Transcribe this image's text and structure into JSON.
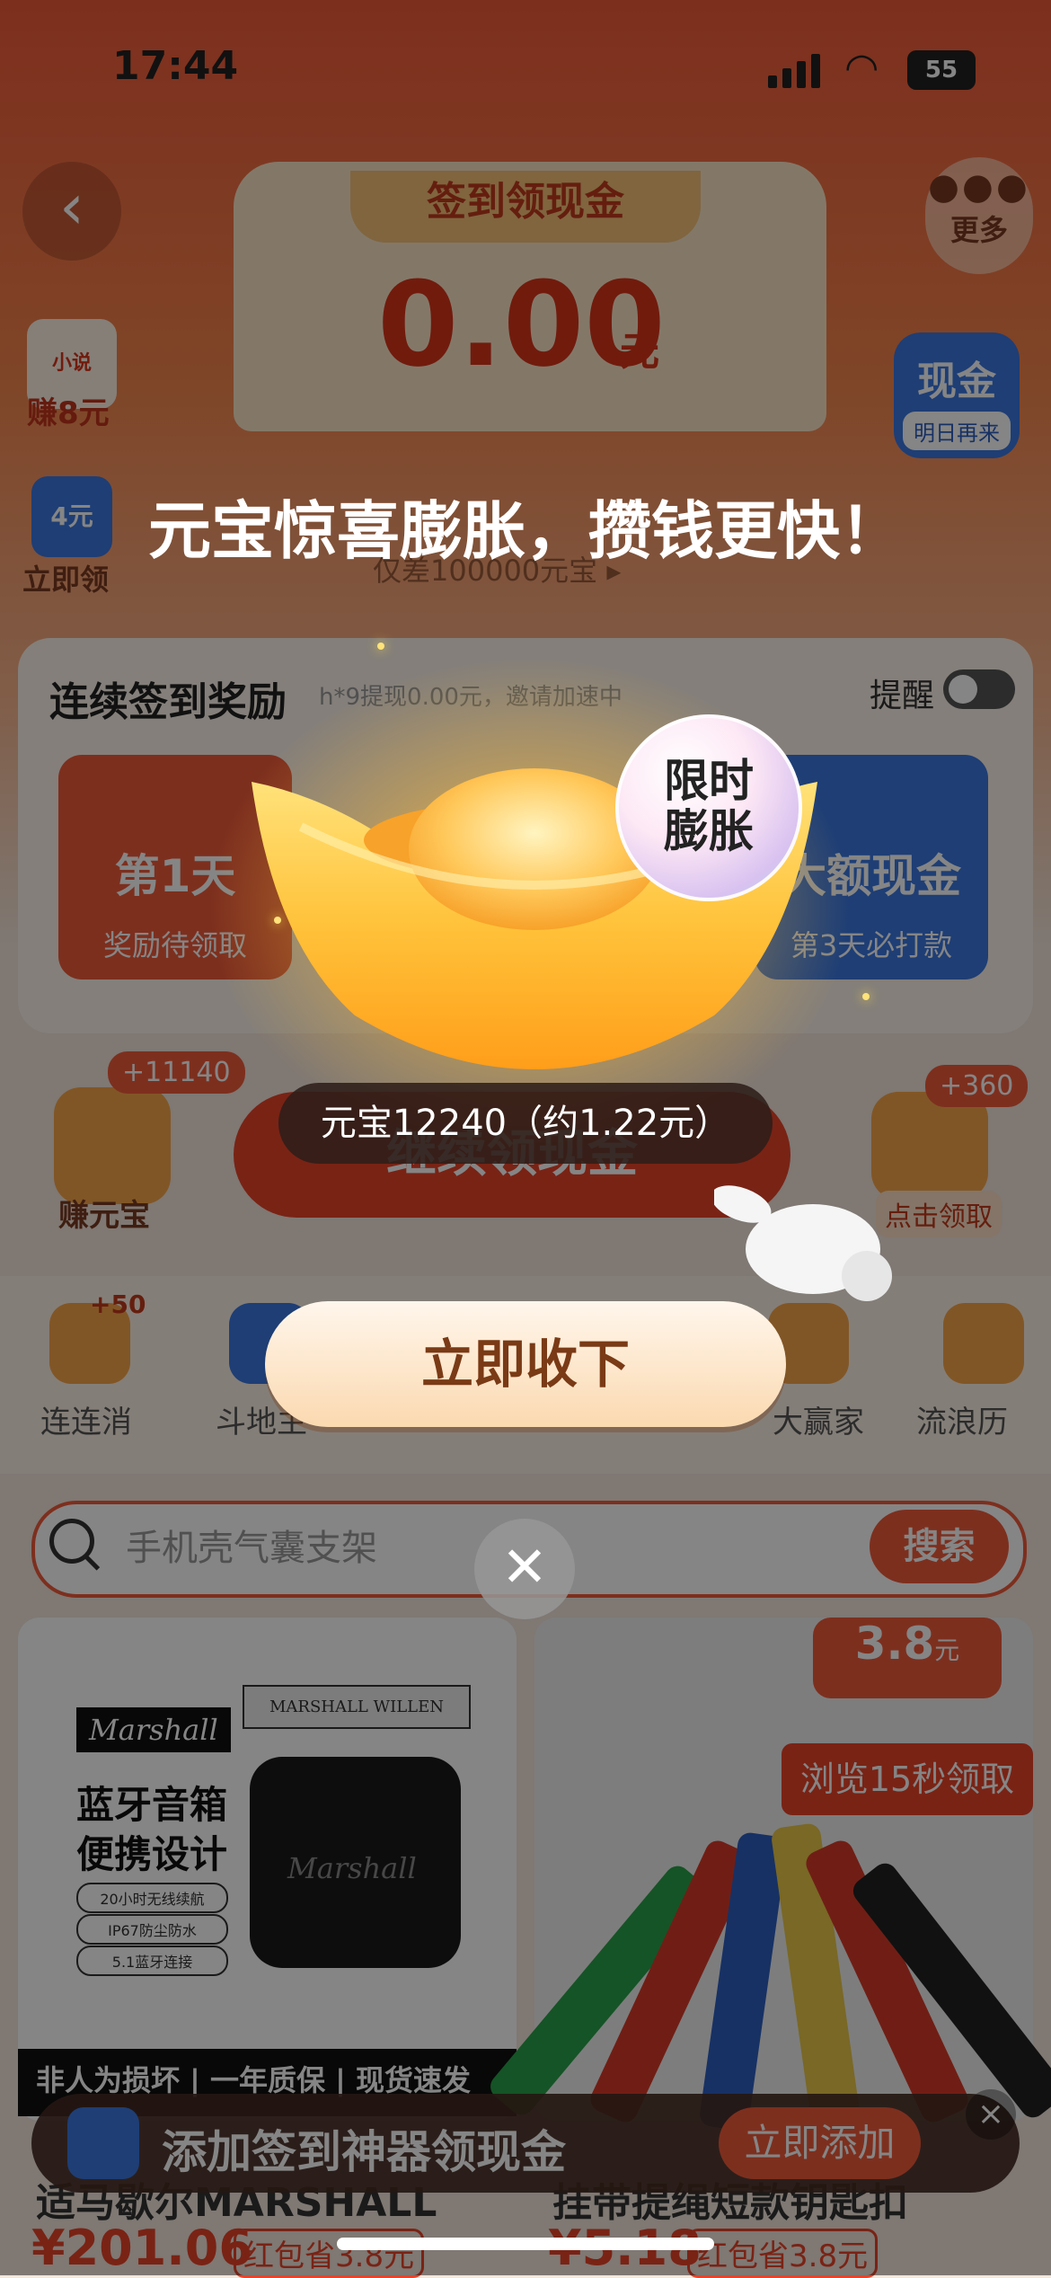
{
  "status_bar": {
    "time": "17:44",
    "battery": "55"
  },
  "header": {
    "back_glyph": "‹",
    "more_label": "更多",
    "card_title": "签到领现金",
    "amount": "0.00",
    "amount_unit": "元",
    "progress_text": "仅差100000元宝 ▸"
  },
  "side_left": [
    {
      "badge": "小说",
      "label": "赚8元"
    },
    {
      "badge": "4元",
      "label": "立即领"
    }
  ],
  "side_right": {
    "title": "现金",
    "sub": "明日再来"
  },
  "reward_panel": {
    "title": "连续签到奖励",
    "subtitle": "h*9提现0.00元，邀请加速中",
    "remind_label": "提醒",
    "day1": {
      "title": "第1天",
      "sub": "奖励待领取"
    },
    "day3": {
      "title": "大额现金",
      "sub": "第3天必打款"
    }
  },
  "actions": {
    "continue_label": "继续领现金",
    "earn_label": "赚元宝",
    "earn_badge": "+11140",
    "click_badge": "+360",
    "click_label": "点击领取"
  },
  "games": {
    "badge": "+50",
    "items": [
      "连连消",
      "斗地主",
      "",
      "",
      "大赢家",
      "流浪历"
    ]
  },
  "search": {
    "placeholder": "手机壳气囊支架",
    "button": "搜索"
  },
  "products": [
    {
      "brand": "Marshall",
      "box_label": "MARSHALL WILLEN",
      "line1": "蓝牙音箱",
      "line2": "便携设计",
      "features": [
        "20小时无线续航",
        "IP67防尘防水",
        "5.1蓝牙连接"
      ],
      "footer": "非人为损坏 | 一年质保 | 现货速发",
      "title": "适马歇尔MARSHALL",
      "price": "¥201.06",
      "coupon": "红包省3.8元"
    },
    {
      "price_tag": "3.8",
      "price_tag_unit": "元",
      "browse_label": "浏览15秒领取",
      "title": "挂带提绳短款钥匙扣",
      "price": "¥5.18",
      "coupon": "红包省3.8元"
    }
  ],
  "bottom_banner": {
    "text": "添加签到神器领现金",
    "button": "立即添加",
    "close": "×"
  },
  "popup": {
    "headline": "元宝惊喜膨胀，攒钱更快！",
    "bubble_line1": "限时",
    "bubble_line2": "膨胀",
    "amount_text": "元宝12240（约1.22元）",
    "accept_button": "立即收下",
    "close_glyph": "✕"
  },
  "colors": {
    "accent": "#f05a3a",
    "blue": "#3a78e0",
    "gold": "#f7b84a"
  }
}
